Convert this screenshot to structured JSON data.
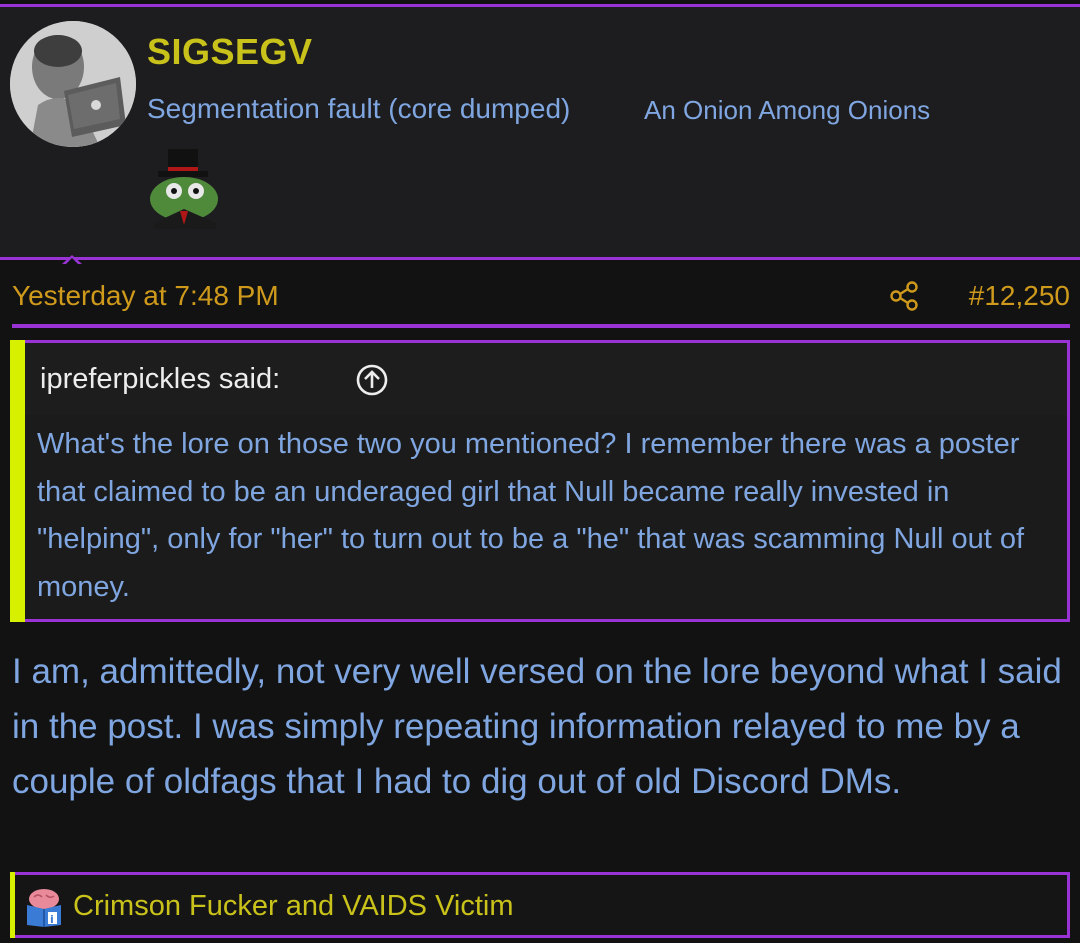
{
  "user": {
    "name": "SIGSEGV",
    "title": "Segmentation fault (core dumped)",
    "banner": "An Onion Among Onions",
    "avatar_icon": "avatar-image",
    "badge_icon": "frog-top-hat-badge"
  },
  "post": {
    "date": "Yesterday at 7:48 PM",
    "number": "#12,250",
    "share_icon": "share-icon"
  },
  "quote": {
    "author": "ipreferpickles said:",
    "body": "What's the lore on those two you mentioned? I remember there was a poster that claimed to be an underaged girl that Null became really invested in \"helping\", only for \"her\" to turn out to be a \"he\" that was scamming Null out of money."
  },
  "body": "I am, admittedly, not very well versed on the lore beyond what I said in the post. I was simply repeating information relayed to me by a couple of oldfags that I had to dig out of old Discord DMs.",
  "signature": {
    "text": "Crimson Fucker and VAIDS Victim",
    "icon": "brain-book-icon"
  },
  "colors": {
    "accent_border": "#9a33d6",
    "username": "#c9c21a",
    "link_text": "#7fa6e0",
    "meta_text": "#cf9a1c",
    "quote_bar": "#d7f000",
    "background": "#121212"
  }
}
